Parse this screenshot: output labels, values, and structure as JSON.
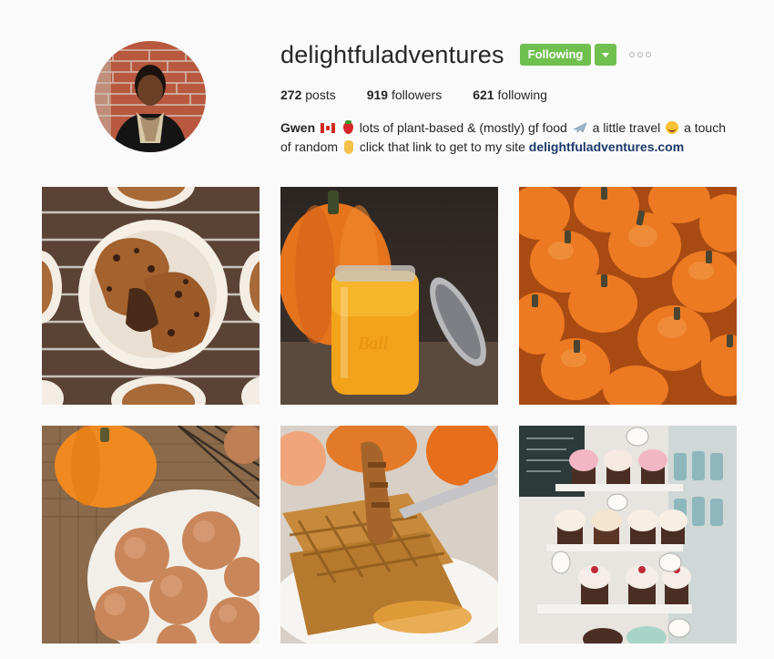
{
  "profile": {
    "username": "delightfuladventures",
    "following_label": "Following",
    "stats": {
      "posts_count": "272",
      "posts_label": "posts",
      "followers_count": "919",
      "followers_label": "followers",
      "following_count": "621",
      "following_label": "following"
    },
    "bio": {
      "name": "Gwen",
      "text_1": "lots of plant-based & (mostly) gf food",
      "text_2": "a little travel",
      "text_3": "a touch of random",
      "text_4": "click that link to get to my site",
      "link": "delightfuladventures.com"
    }
  },
  "icons": {
    "dropdown": "chevron-down-icon",
    "more": "more-options-icon",
    "flag": "canada-flag-emoji",
    "strawberry": "strawberry-emoji",
    "plane": "airplane-emoji",
    "face": "grinning-face-emoji",
    "hand": "pointing-down-emoji"
  },
  "posts": [
    {
      "subject": "pumpkin muffins on cooling rack"
    },
    {
      "subject": "pumpkin puree in mason jar"
    },
    {
      "subject": "pile of pumpkins"
    },
    {
      "subject": "cinnamon sugar donut holes"
    },
    {
      "subject": "pumpkin waffles with fork"
    },
    {
      "subject": "cupcake display shop"
    }
  ],
  "colors": {
    "follow_green": "#70c050",
    "link_blue": "#1c3a6b",
    "background": "#fafafa"
  }
}
